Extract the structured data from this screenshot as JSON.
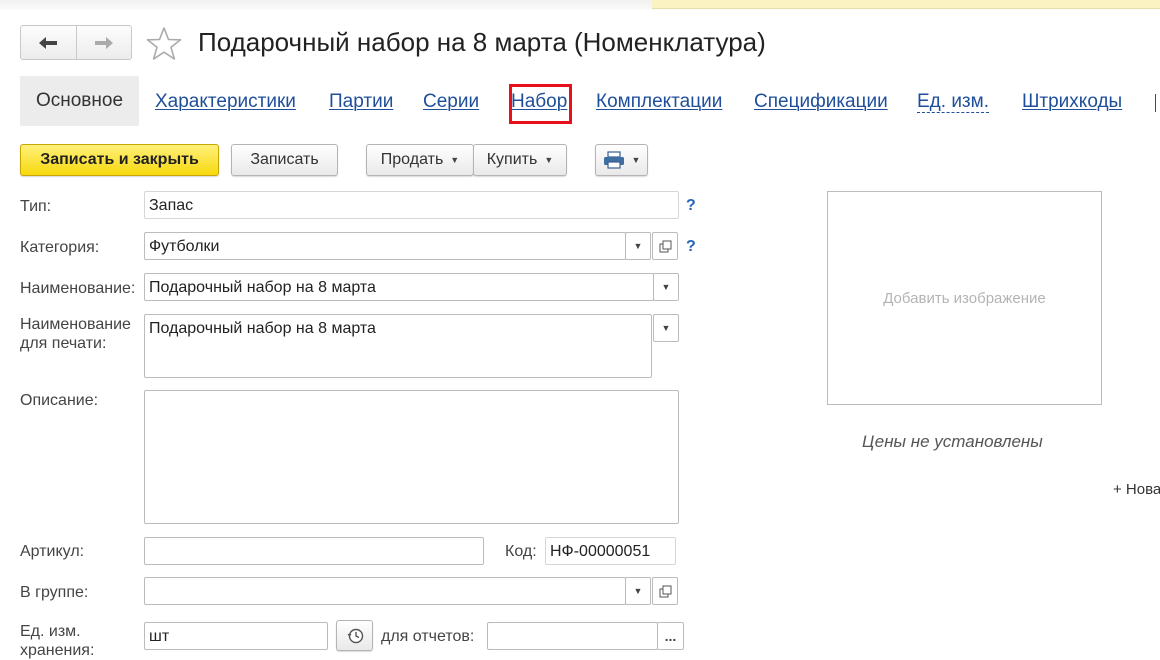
{
  "window": {
    "title": "Подарочный набор на 8 марта (Номенклатура)"
  },
  "nav": {
    "back_icon": "arrow-left-icon",
    "forward_icon": "arrow-right-icon",
    "favorite_icon": "star-icon"
  },
  "tabs": [
    {
      "label": "Основное",
      "active": true
    },
    {
      "label": "Характеристики"
    },
    {
      "label": "Партии"
    },
    {
      "label": "Серии"
    },
    {
      "label": "Набор",
      "highlighted": true
    },
    {
      "label": "Комплектации"
    },
    {
      "label": "Спецификации"
    },
    {
      "label": "Ед. изм."
    },
    {
      "label": "Штрихкоды"
    }
  ],
  "toolbar": {
    "save_close": "Записать и закрыть",
    "save": "Записать",
    "sell": "Продать",
    "buy": "Купить",
    "print_icon": "printer-icon"
  },
  "form": {
    "type_label": "Тип:",
    "type_value": "Запас",
    "category_label": "Категория:",
    "category_value": "Футболки",
    "name_label": "Наименование:",
    "name_value": "Подарочный набор на 8 марта",
    "print_name_label_1": "Наименование",
    "print_name_label_2": "для печати:",
    "print_name_value": "Подарочный набор на 8 марта",
    "description_label": "Описание:",
    "description_value": "",
    "article_label": "Артикул:",
    "article_value": "",
    "code_label": "Код:",
    "code_value": "НФ-00000051",
    "group_label": "В группе:",
    "group_value": "",
    "unit_label_1": "Ед. изм.",
    "unit_label_2": "хранения:",
    "unit_value": "шт",
    "reports_label": "для отчетов:",
    "reports_value": "",
    "help": "?",
    "ellipsis": "..."
  },
  "side": {
    "add_image": "Добавить изображение",
    "no_prices": "Цены не установлены",
    "new_link": "+ Нова"
  },
  "colors": {
    "primary_button": "#f7d90e",
    "link": "#1f4f9a",
    "highlight": "#e8101a"
  }
}
